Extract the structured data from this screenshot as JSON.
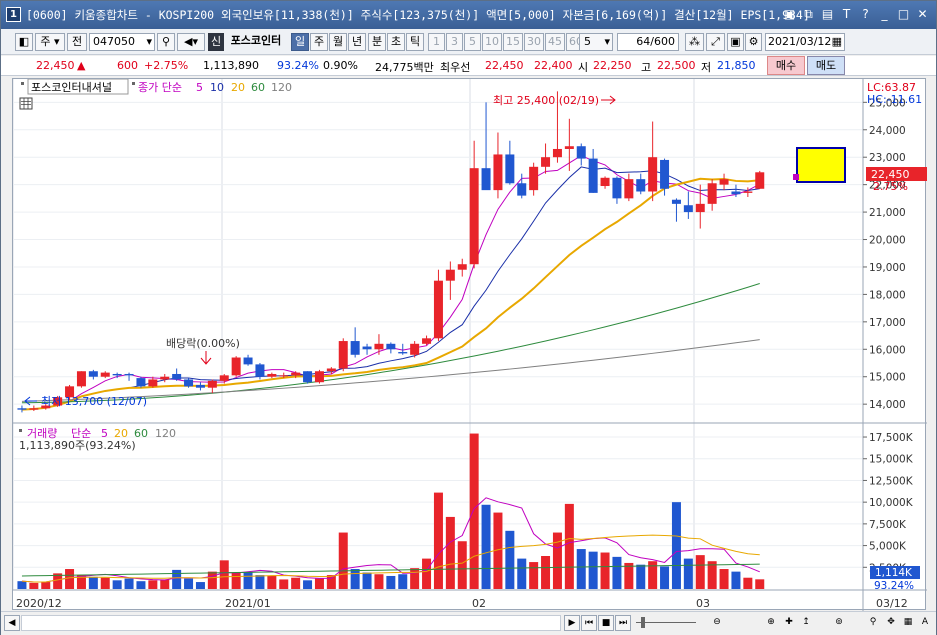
{
  "window": {
    "num": "1",
    "title": "[0600] 키움종합차트 - KOSPI200 외국인보유[11,338(천)] 주식수[123,375(천)] 액면[5,000] 자본금[6,169(억)] 결산[12월] EPS[1,934]"
  },
  "toolbar": {
    "kind": "주",
    "prev": "전",
    "code": "047050",
    "sin": "신",
    "name": "포스코인터",
    "periods": [
      "일",
      "주",
      "월",
      "년",
      "분",
      "초",
      "틱"
    ],
    "nums": [
      "1",
      "3",
      "5",
      "10",
      "15",
      "30",
      "45",
      "60"
    ],
    "count_sel": "5",
    "count_text": "64/600",
    "date": "2021/03/12"
  },
  "quote": {
    "price": "22,450",
    "arrow": "▲",
    "change": "600",
    "rate": "+2.75%",
    "volume": "1,113,890",
    "vol_ratio": "93.24%",
    "turnover": "0.90%",
    "amount": "24,775백만",
    "best_label": "최우선",
    "best_ask": "22,450",
    "best_bid": "22,400",
    "open_label": "시",
    "open": "22,250",
    "high_label": "고",
    "high": "22,500",
    "low_label": "저",
    "low": "21,850",
    "buy": "매수",
    "sell": "매도"
  },
  "price_panel": {
    "legend_name": "포스코인터내셔널",
    "legend_ma": "종가 단순",
    "ma": [
      "5",
      "10",
      "20",
      "60",
      "120"
    ],
    "lc": "LC:63.87",
    "hc": "HC:-11.61",
    "high_note": "최고 25,400 (02/19)",
    "low_note": "최저 13,700 (12/07)",
    "dividend": "배당락(0.00%)",
    "last_label": "22,450",
    "rate_label": "2.75%",
    "yticks": [
      "25,000",
      "24,000",
      "23,000",
      "22,000",
      "21,000",
      "20,000",
      "19,000",
      "18,000",
      "17,000",
      "16,000",
      "15,000",
      "14,000"
    ]
  },
  "volume_panel": {
    "legend_name": "거래량",
    "legend_ma": "단순",
    "ma": [
      "5",
      "20",
      "60",
      "120"
    ],
    "vol_text": "1,113,890주(93.24%)",
    "yticks": [
      "17,500K",
      "15,000K",
      "12,500K",
      "10,000K",
      "7,500K",
      "5,000K",
      "2,500K"
    ],
    "last_label": "1,114K",
    "ratio_label": "93.24%"
  },
  "xaxis": {
    "labels": [
      "2020/12",
      "2021/01",
      "02",
      "03"
    ],
    "right": "03/12"
  },
  "colors": {
    "up": "#e8242a",
    "down": "#2057d0",
    "ma5": "#c000c0",
    "ma10": "#1a2fa8",
    "ma20": "#e8a800",
    "ma60": "#2e8b3e",
    "ma120": "#808080"
  },
  "chart_data": {
    "type": "candlestick",
    "columns": [
      "open",
      "high",
      "low",
      "close",
      "volume_k"
    ],
    "candles": [
      [
        13850,
        13950,
        13700,
        13800,
        900
      ],
      [
        13800,
        13950,
        13750,
        13850,
        700
      ],
      [
        13850,
        14000,
        13800,
        13950,
        800
      ],
      [
        13950,
        14300,
        13900,
        14250,
        1800
      ],
      [
        14250,
        14700,
        14150,
        14650,
        2300
      ],
      [
        14650,
        15200,
        14600,
        15200,
        1600
      ],
      [
        15200,
        15250,
        14900,
        15000,
        1400
      ],
      [
        15000,
        15200,
        14950,
        15150,
        1300
      ],
      [
        15100,
        15150,
        14950,
        15050,
        1000
      ],
      [
        15100,
        15150,
        14850,
        15050,
        1200
      ],
      [
        14950,
        15000,
        14600,
        14650,
        900
      ],
      [
        14650,
        15000,
        14600,
        14900,
        1000
      ],
      [
        14900,
        15100,
        14800,
        15000,
        1100
      ],
      [
        15100,
        15300,
        14850,
        14900,
        2200
      ],
      [
        14900,
        14950,
        14600,
        14650,
        1200
      ],
      [
        14700,
        14800,
        14500,
        14600,
        800
      ],
      [
        14600,
        14900,
        14400,
        14850,
        2000
      ],
      [
        14850,
        15100,
        14750,
        15050,
        3300
      ],
      [
        15050,
        15750,
        15000,
        15700,
        1900
      ],
      [
        15700,
        15800,
        15400,
        15450,
        1900
      ],
      [
        15450,
        15500,
        14900,
        15000,
        1600
      ],
      [
        15000,
        15150,
        14950,
        15100,
        1500
      ],
      [
        15050,
        15150,
        14950,
        15050,
        1100
      ],
      [
        15050,
        15200,
        14950,
        15150,
        1300
      ],
      [
        15200,
        15200,
        14750,
        14800,
        1000
      ],
      [
        14800,
        15250,
        14750,
        15200,
        1200
      ],
      [
        15200,
        15350,
        15100,
        15300,
        1600
      ],
      [
        15300,
        16400,
        15200,
        16300,
        6500
      ],
      [
        16300,
        16800,
        15700,
        15800,
        2300
      ],
      [
        16100,
        16200,
        15800,
        16000,
        1900
      ],
      [
        16000,
        16550,
        15800,
        16200,
        1700
      ],
      [
        16200,
        16250,
        15850,
        16000,
        1500
      ],
      [
        15900,
        16200,
        15800,
        15850,
        1700
      ],
      [
        15800,
        16300,
        15700,
        16200,
        2400
      ],
      [
        16200,
        16500,
        16150,
        16400,
        3500
      ],
      [
        16400,
        18900,
        16300,
        18500,
        11100
      ],
      [
        18500,
        19200,
        17800,
        18900,
        8300
      ],
      [
        18900,
        19300,
        18650,
        19100,
        5500
      ],
      [
        19100,
        23600,
        18950,
        22600,
        17900
      ],
      [
        22600,
        25000,
        22000,
        21800,
        9700
      ],
      [
        21800,
        23900,
        21500,
        23100,
        8800
      ],
      [
        23100,
        23600,
        22000,
        22050,
        6700
      ],
      [
        22050,
        22400,
        21500,
        21600,
        3500
      ],
      [
        21800,
        22800,
        21600,
        22650,
        3100
      ],
      [
        22650,
        23500,
        22400,
        23000,
        3800
      ],
      [
        23000,
        25400,
        22800,
        23300,
        6500
      ],
      [
        23300,
        24400,
        22500,
        23400,
        9800
      ],
      [
        23400,
        23500,
        22700,
        22950,
        4600
      ],
      [
        22950,
        23300,
        21700,
        21700,
        4300
      ],
      [
        21950,
        22300,
        21850,
        22250,
        4200
      ],
      [
        22250,
        22300,
        21300,
        21500,
        3700
      ],
      [
        21500,
        22400,
        21400,
        22200,
        3000
      ],
      [
        22200,
        22400,
        21650,
        21750,
        2800
      ],
      [
        21750,
        24300,
        21400,
        23000,
        3200
      ],
      [
        22900,
        22950,
        21600,
        21850,
        2600
      ],
      [
        21450,
        21500,
        20650,
        21300,
        10000
      ],
      [
        21250,
        21750,
        20750,
        21000,
        3500
      ],
      [
        21000,
        22000,
        20400,
        21300,
        3900
      ],
      [
        21300,
        22200,
        21050,
        22050,
        3200
      ],
      [
        22000,
        22400,
        21800,
        22200,
        2300
      ],
      [
        21750,
        22000,
        21550,
        21650,
        2000
      ],
      [
        21700,
        21900,
        21550,
        21750,
        1300
      ],
      [
        21850,
        22500,
        21850,
        22450,
        1114
      ]
    ],
    "ylim_price": [
      13350,
      25850
    ],
    "ylim_volume": [
      0,
      19000
    ]
  }
}
